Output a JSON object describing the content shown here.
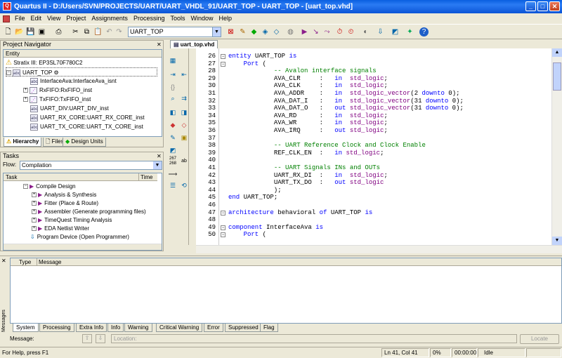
{
  "window": {
    "title": "Quartus II - D:/Users/SVN/PROJECTS/UART/UART_VHDL_91/UART_TOP - UART_TOP - [uart_top.vhd]",
    "min": "_",
    "max": "□",
    "close": "✕"
  },
  "menu": [
    "File",
    "Edit",
    "View",
    "Project",
    "Assignments",
    "Processing",
    "Tools",
    "Window",
    "Help"
  ],
  "toolbar": {
    "entity_combo": "UART_TOP"
  },
  "navigator": {
    "title": "Project Navigator",
    "column": "Entity",
    "device": "Stratix III: EP3SL70F780C2",
    "top": "UART_TOP",
    "items": [
      "InterfaceAva:InterfaceAva_isnt",
      "RxFIFO:RxFIFO_inst",
      "TxFIFO:TxFIFO_inst",
      "UART_DIV:UART_DIV_inst",
      "UART_RX_CORE:UART_RX_CORE_inst",
      "UART_TX_CORE:UART_TX_CORE_inst"
    ],
    "tabs": [
      "Hierarchy",
      "Files",
      "Design Units"
    ]
  },
  "tasks": {
    "title": "Tasks",
    "flow_label": "Flow:",
    "flow_value": "Compilation",
    "col_task": "Task",
    "col_time": "Time",
    "items": [
      "Compile Design",
      "Analysis & Synthesis",
      "Fitter (Place & Route)",
      "Assembler (Generate programming files)",
      "TimeQuest Timing Analysis",
      "EDA Netlist Writer",
      "Program Device (Open Programmer)"
    ]
  },
  "editor": {
    "tab": "uart_top.vhd",
    "lines": [
      {
        "n": "26",
        "t": "entity UART_TOP is"
      },
      {
        "n": "27",
        "t": "    Port ("
      },
      {
        "n": "28",
        "t": "            -- Avalon interface signals"
      },
      {
        "n": "29",
        "t": "            AVA_CLR     :   in  std_logic;"
      },
      {
        "n": "30",
        "t": "            AVA_CLK     :   in  std_logic;"
      },
      {
        "n": "31",
        "t": "            AVA_ADDR    :   in  std_logic_vector(2 downto 0);"
      },
      {
        "n": "32",
        "t": "            AVA_DAT_I   :   in  std_logic_vector(31 downto 0);"
      },
      {
        "n": "33",
        "t": "            AVA_DAT_O   :   out std_logic_vector(31 downto 0);"
      },
      {
        "n": "34",
        "t": "            AVA_RD      :   in  std_logic;"
      },
      {
        "n": "35",
        "t": "            AVA_WR      :   in  std_logic;"
      },
      {
        "n": "36",
        "t": "            AVA_IRQ     :   out std_logic;"
      },
      {
        "n": "37",
        "t": ""
      },
      {
        "n": "38",
        "t": "            -- UART Reference Clock and Clock Enable"
      },
      {
        "n": "39",
        "t": "            REF_CLK_EN  :   in std_logic;"
      },
      {
        "n": "40",
        "t": ""
      },
      {
        "n": "41",
        "t": "            -- UART Signals INs and OUTs"
      },
      {
        "n": "42",
        "t": "            UART_RX_DI  :   in  std_logic;"
      },
      {
        "n": "43",
        "t": "            UART_TX_DO  :   out std_logic"
      },
      {
        "n": "44",
        "t": "            );"
      },
      {
        "n": "45",
        "t": "end UART_TOP;"
      },
      {
        "n": "46",
        "t": ""
      },
      {
        "n": "47",
        "t": "architecture behavioral of UART_TOP is"
      },
      {
        "n": "48",
        "t": ""
      },
      {
        "n": "49",
        "t": "component InterfaceAva is"
      },
      {
        "n": "50",
        "t": "    Port ("
      }
    ]
  },
  "messages": {
    "col_type": "Type",
    "col_message": "Message",
    "side_label": "Messages",
    "tabs": [
      "System",
      "Processing",
      "Extra Info",
      "Info",
      "Warning",
      "Critical Warning",
      "Error",
      "Suppressed",
      "Flag"
    ],
    "filter_label": "Message:",
    "location_placeholder": "Location:",
    "locate": "Locate"
  },
  "status": {
    "help": "For Help, press F1",
    "position": "Ln 41, Col 41",
    "percent": "0%",
    "time": "00:00:00",
    "state": "Idle"
  }
}
